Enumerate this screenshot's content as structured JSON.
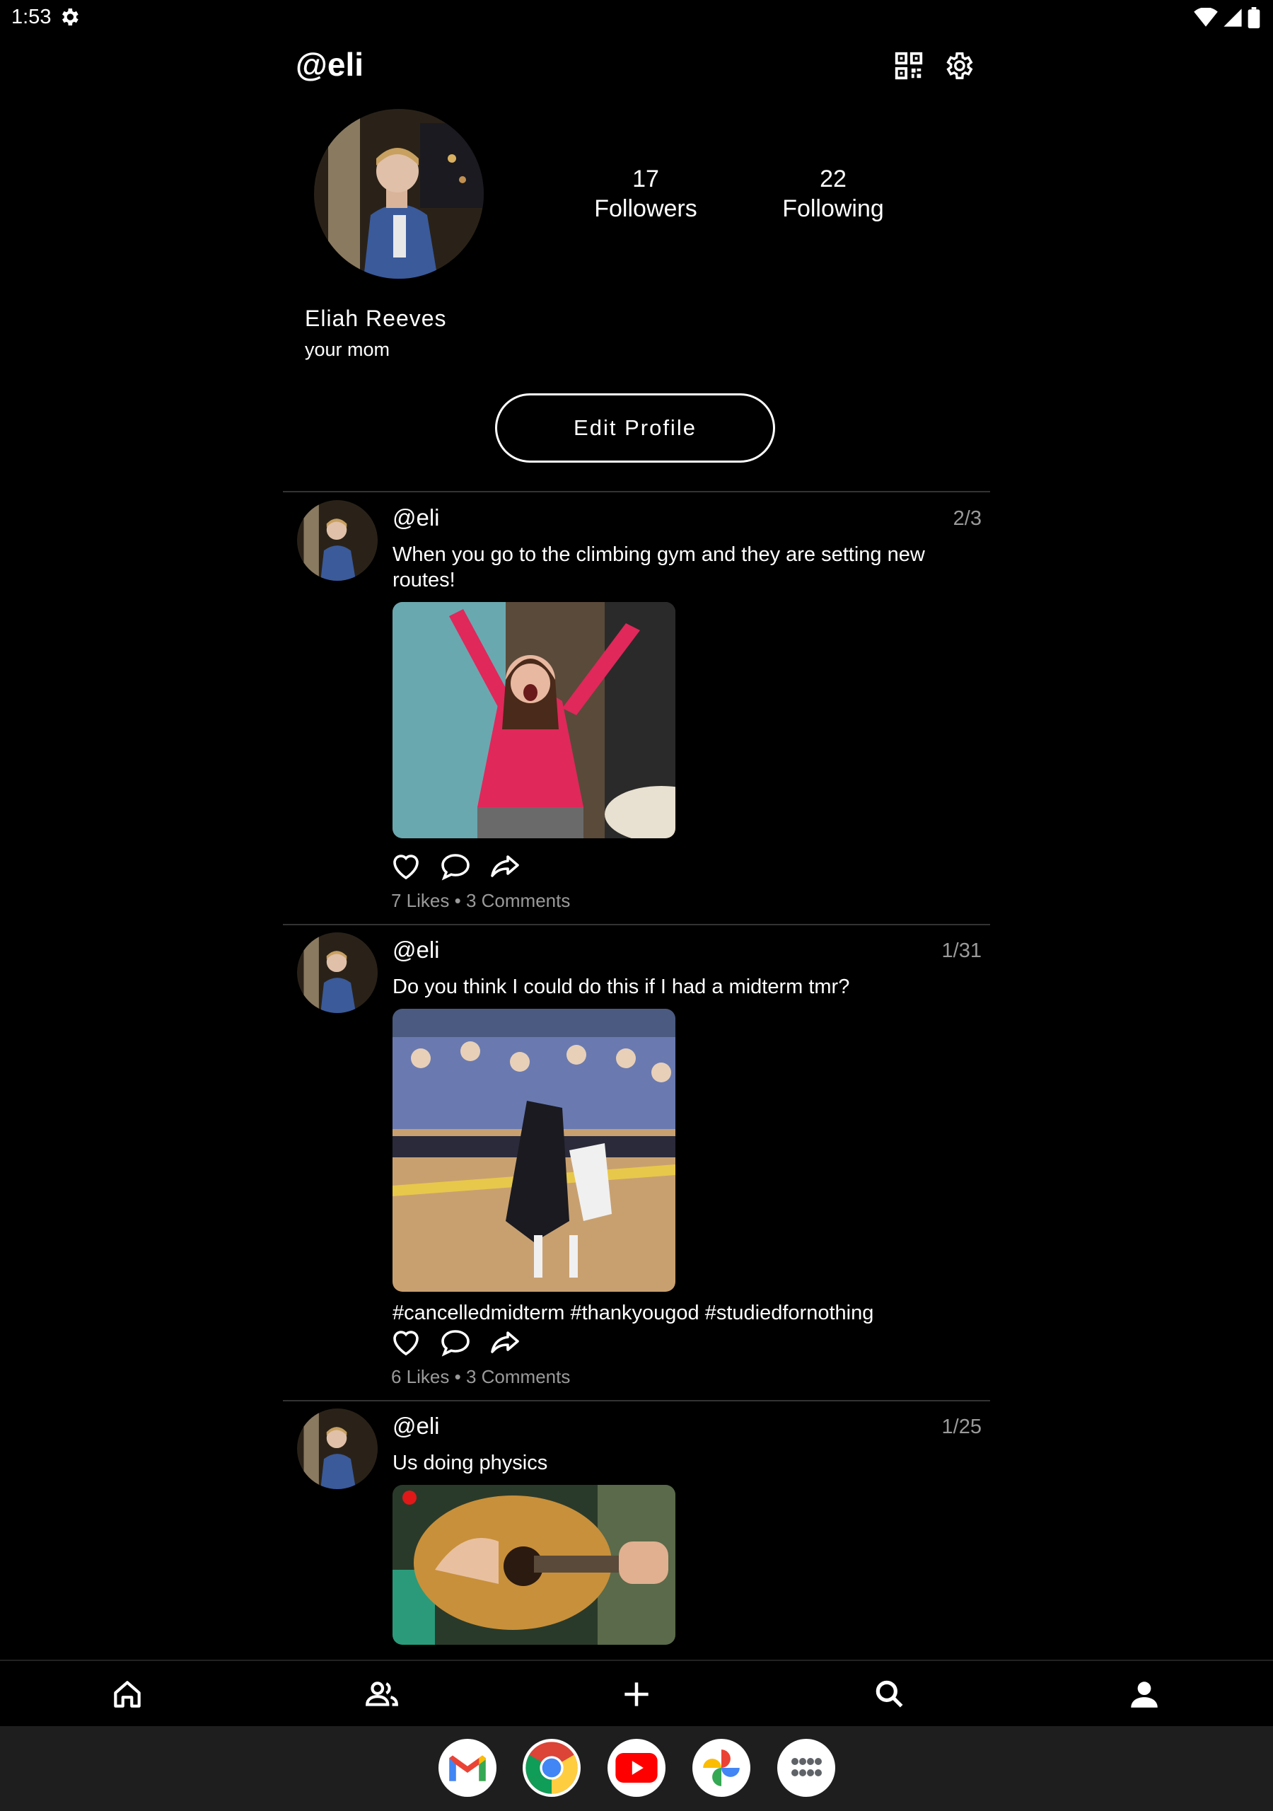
{
  "status_bar": {
    "time": "1:53"
  },
  "header": {
    "username": "@eli"
  },
  "profile": {
    "followers_count": "17",
    "followers_label": "Followers",
    "following_count": "22",
    "following_label": "Following",
    "display_name": "Eliah Reeves",
    "bio": "your mom",
    "edit_button": "Edit Profile"
  },
  "posts": [
    {
      "handle": "@eli",
      "date": "2/3",
      "text": "When you go to the climbing gym and they are setting new routes!",
      "hashtags": "",
      "likes": "7 Likes",
      "comments": "3 Comments"
    },
    {
      "handle": "@eli",
      "date": "1/31",
      "text": "Do you think I could do this if I had a midterm tmr?",
      "hashtags": "#cancelledmidterm #thankyougod #studiedfornothing",
      "likes": "6 Likes",
      "comments": "3 Comments"
    },
    {
      "handle": "@eli",
      "date": "1/25",
      "text": "Us doing physics",
      "hashtags": "",
      "likes": "",
      "comments": ""
    }
  ],
  "meta_separator": "•",
  "colors": {
    "background": "#000000",
    "muted_text": "#9a9a9a",
    "divider": "#333333",
    "dock": "#1e1e1e"
  },
  "bottom_nav": [
    "home-icon",
    "friends-icon",
    "add-icon",
    "search-icon",
    "profile-icon"
  ],
  "dock_apps": [
    "gmail-icon",
    "chrome-icon",
    "youtube-icon",
    "photos-icon",
    "app-drawer-icon"
  ]
}
